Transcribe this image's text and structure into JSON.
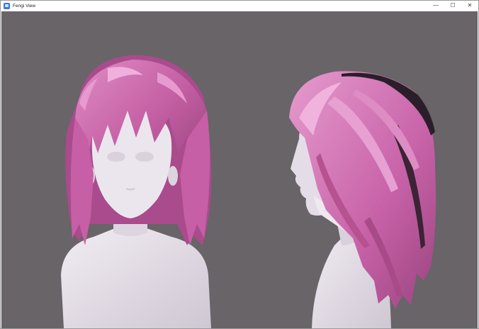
{
  "window": {
    "title": "Fengi View",
    "icon": "app-icon",
    "controls": {
      "minimize": "—",
      "maximize": "☐",
      "close": "✕"
    }
  },
  "viewport": {
    "background": "#686468",
    "hair_color": "#c45fa3",
    "skin_color": "#e2dce6"
  }
}
